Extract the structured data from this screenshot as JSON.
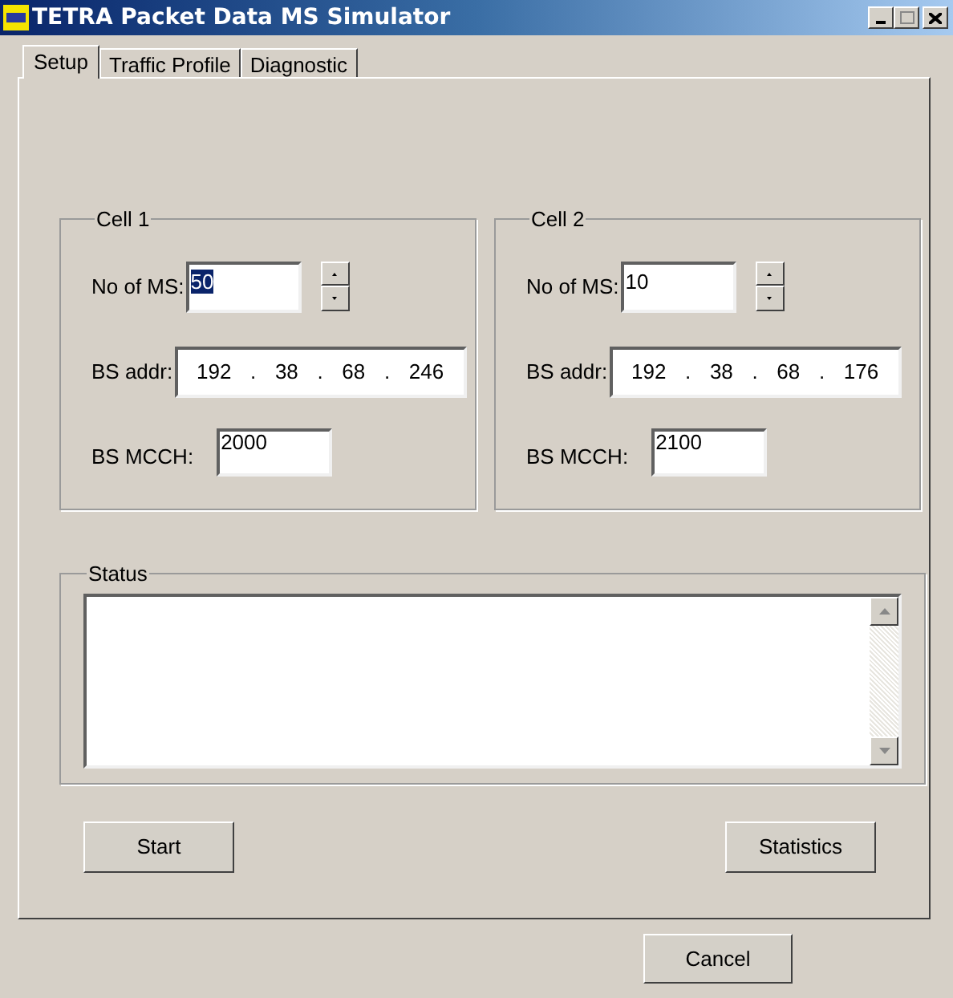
{
  "window": {
    "title": "TETRA Packet Data MS Simulator"
  },
  "tabs": [
    {
      "label": "Setup",
      "selected": true
    },
    {
      "label": "Traffic Profile",
      "selected": false
    },
    {
      "label": "Diagnostic",
      "selected": false
    }
  ],
  "cells": [
    {
      "title": "Cell 1",
      "ms_label": "No of MS:",
      "ms_value": "50",
      "ms_value_highlighted": true,
      "addr_label": "BS addr:",
      "addr_octets": [
        "192",
        "38",
        "68",
        "246"
      ],
      "addr_separator": ".",
      "mcch_label": "BS MCCH:",
      "mcch_value": "2000"
    },
    {
      "title": "Cell 2",
      "ms_label": "No of MS:",
      "ms_value": "10",
      "ms_value_highlighted": false,
      "addr_label": "BS addr:",
      "addr_octets": [
        "192",
        "38",
        "68",
        "176"
      ],
      "addr_separator": ".",
      "mcch_label": "BS MCCH:",
      "mcch_value": "2100"
    }
  ],
  "status": {
    "title": "Status"
  },
  "buttons": {
    "start": "Start",
    "statistics": "Statistics",
    "cancel": "Cancel"
  }
}
